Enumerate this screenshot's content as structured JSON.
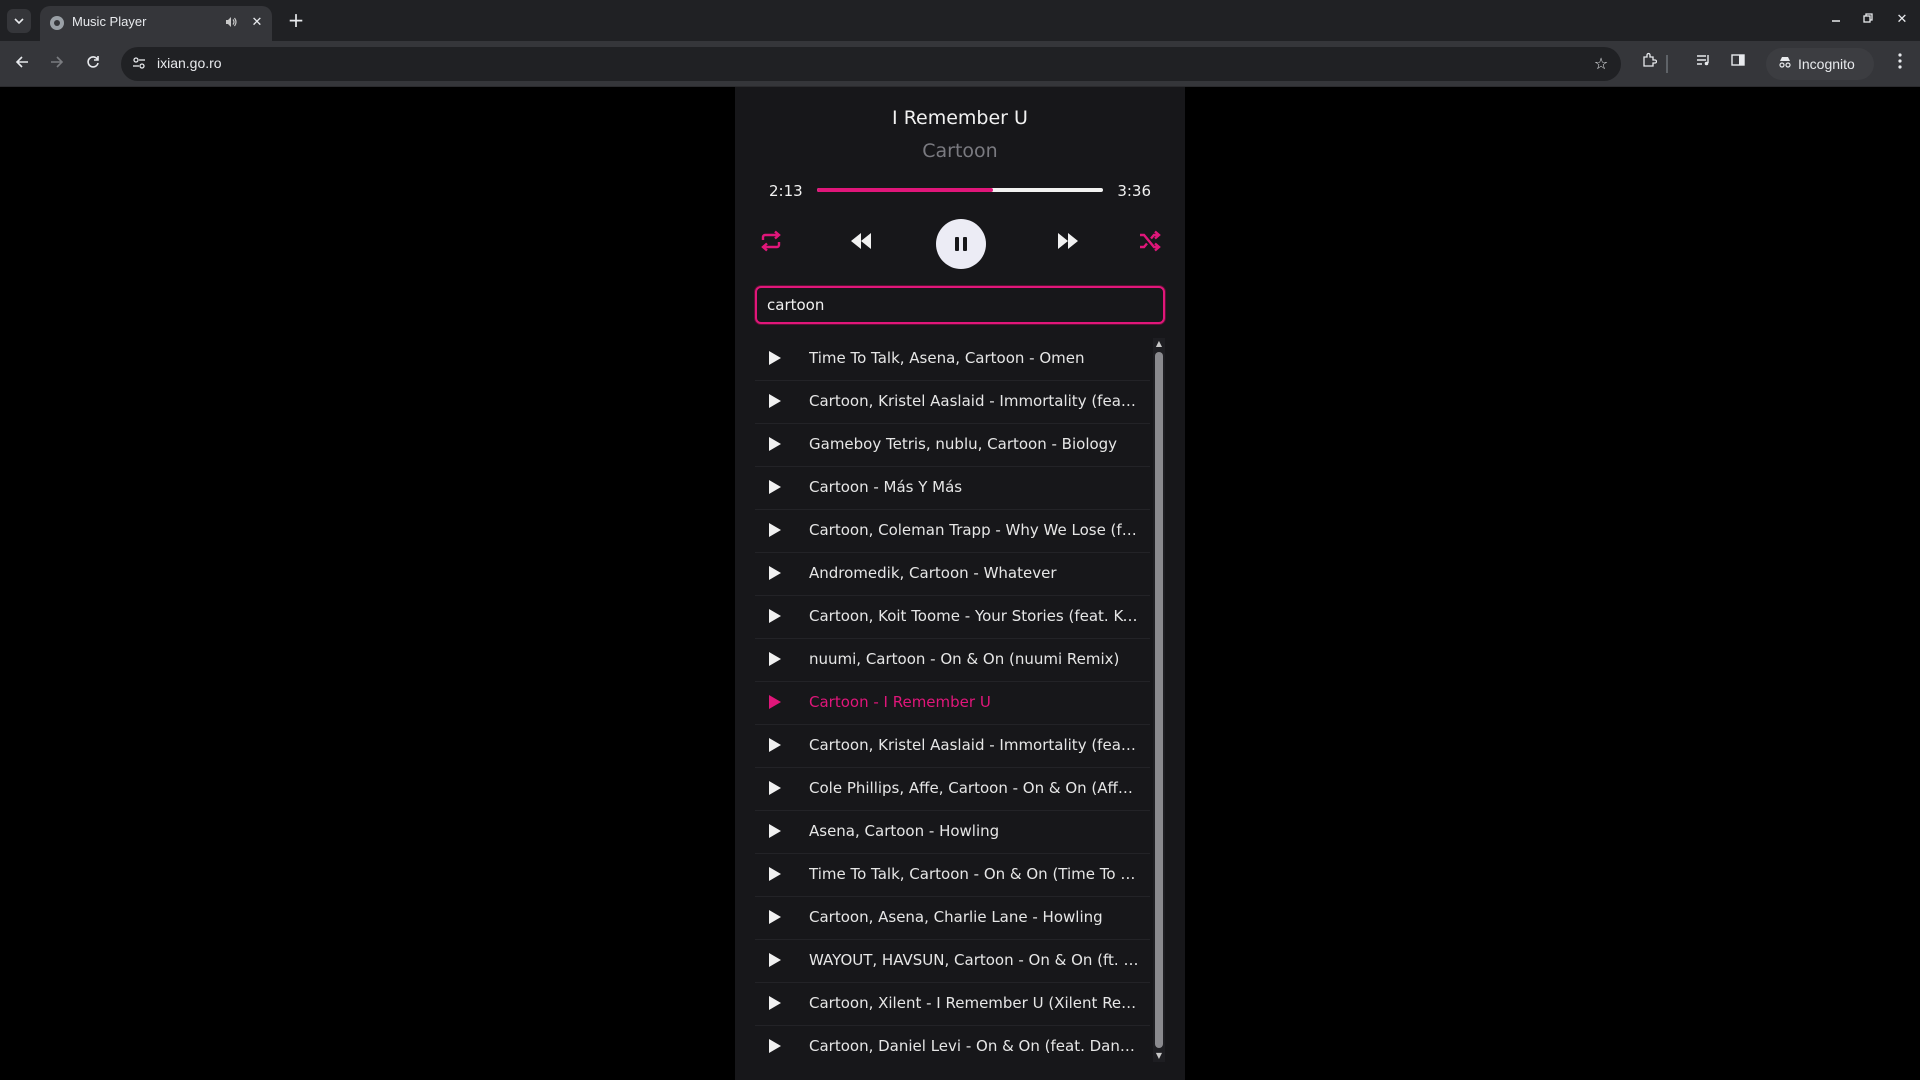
{
  "browser": {
    "tab_title": "Music Player",
    "url": "ixian.go.ro",
    "incognito_label": "Incognito"
  },
  "player": {
    "title": "I Remember U",
    "artist": "Cartoon",
    "current_time": "2:13",
    "duration": "3:36",
    "progress_fraction": 0.616,
    "accent_color": "#e0167a",
    "controls": [
      "repeat-icon",
      "previous-icon",
      "pause-icon",
      "next-icon",
      "shuffle-icon"
    ]
  },
  "search": {
    "value": "cartoon"
  },
  "playlist": [
    {
      "label": "Time To Talk, Asena, Cartoon - Omen",
      "active": false
    },
    {
      "label": "Cartoon, Kristel Aaslaid - Immortality (feat. Kristel Aaslaid)",
      "active": false
    },
    {
      "label": "Gameboy Tetris, nublu, Cartoon - Biology",
      "active": false
    },
    {
      "label": "Cartoon - Más Y Más",
      "active": false
    },
    {
      "label": "Cartoon, Coleman Trapp - Why We Lose (feat. Coleman Trapp)",
      "active": false
    },
    {
      "label": "Andromedik, Cartoon - Whatever",
      "active": false
    },
    {
      "label": "Cartoon, Koit Toome - Your Stories (feat. Koit Toome)",
      "active": false
    },
    {
      "label": "nuumi, Cartoon - On & On (nuumi Remix)",
      "active": false
    },
    {
      "label": "Cartoon - I Remember U",
      "active": true
    },
    {
      "label": "Cartoon, Kristel Aaslaid - Immortality (feat. Kristel Aaslaid)",
      "active": false
    },
    {
      "label": "Cole Phillips, Affe, Cartoon - On & On (Affe & Cole Phillips Remix)",
      "active": false
    },
    {
      "label": "Asena, Cartoon - Howling",
      "active": false
    },
    {
      "label": "Time To Talk, Cartoon - On & On (Time To Talk Remix)",
      "active": false
    },
    {
      "label": "Cartoon, Asena, Charlie Lane - Howling",
      "active": false
    },
    {
      "label": "WAYOUT, HAVSUN, Cartoon - On & On (ft. Daniel Levi)",
      "active": false
    },
    {
      "label": "Cartoon, Xilent - I Remember U (Xilent Remix)",
      "active": false
    },
    {
      "label": "Cartoon, Daniel Levi - On & On (feat. Daniel Levi)",
      "active": false
    }
  ]
}
